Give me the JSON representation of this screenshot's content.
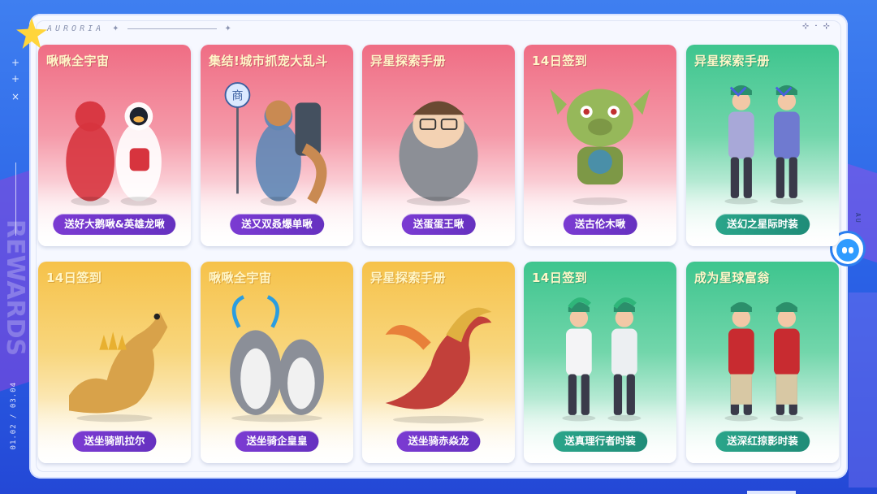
{
  "header": {
    "brand": "AURORIA",
    "sparkle_icon": "sparkle-icon",
    "corner_icons": [
      "⊹",
      "·",
      "⊹"
    ]
  },
  "side": {
    "watermark": "REWARDS",
    "code": "01.02 / 03.04"
  },
  "right_rail": {
    "vertical_text": "AU"
  },
  "cards": [
    {
      "tag": "啾啾全宇宙",
      "label": "送好大鹅啾&英雄龙啾",
      "theme": "pink",
      "pill": "purple",
      "art": "mascot-pair-icon"
    },
    {
      "tag": "集结!城市抓宠大乱斗",
      "label": "送又双叒爆单啾",
      "theme": "pink",
      "pill": "purple",
      "art": "squirrel-courier-icon"
    },
    {
      "tag": "异星探索手册",
      "label": "送蛋蛋王啾",
      "theme": "pink",
      "pill": "purple",
      "art": "egg-man-icon"
    },
    {
      "tag": "14日签到",
      "label": "送古伦木啾",
      "theme": "pink",
      "pill": "purple",
      "art": "goblin-pig-icon"
    },
    {
      "tag": "异星探索手册",
      "label": "送幻之星际时装",
      "theme": "teal",
      "pill": "teal",
      "art": "star-outfit-pair-icon"
    },
    {
      "tag": "14日签到",
      "label": "送坐骑凯拉尔",
      "theme": "gold",
      "pill": "purple",
      "art": "dragon-mount-icon"
    },
    {
      "tag": "啾啾全宇宙",
      "label": "送坐骑企皇皇",
      "theme": "gold",
      "pill": "purple",
      "art": "penguin-mount-icon"
    },
    {
      "tag": "异星探索手册",
      "label": "送坐骑赤焱龙",
      "theme": "gold",
      "pill": "purple",
      "art": "fire-dragon-icon"
    },
    {
      "tag": "14日签到",
      "label": "送真理行者时装",
      "theme": "teal",
      "pill": "teal",
      "art": "lab-coat-pair-icon"
    },
    {
      "tag": "成为星球富翁",
      "label": "送深红掠影时装",
      "theme": "teal",
      "pill": "teal",
      "art": "red-jacket-pair-icon"
    }
  ],
  "colors": {
    "background": "#2f6ded",
    "panel": "#f6f8ff",
    "pink": "#ef6d84",
    "gold": "#f6c24a",
    "teal": "#3ec58e",
    "pill_purple": "#6f36c9",
    "pill_teal": "#24998a",
    "star": "#ffd53b"
  }
}
